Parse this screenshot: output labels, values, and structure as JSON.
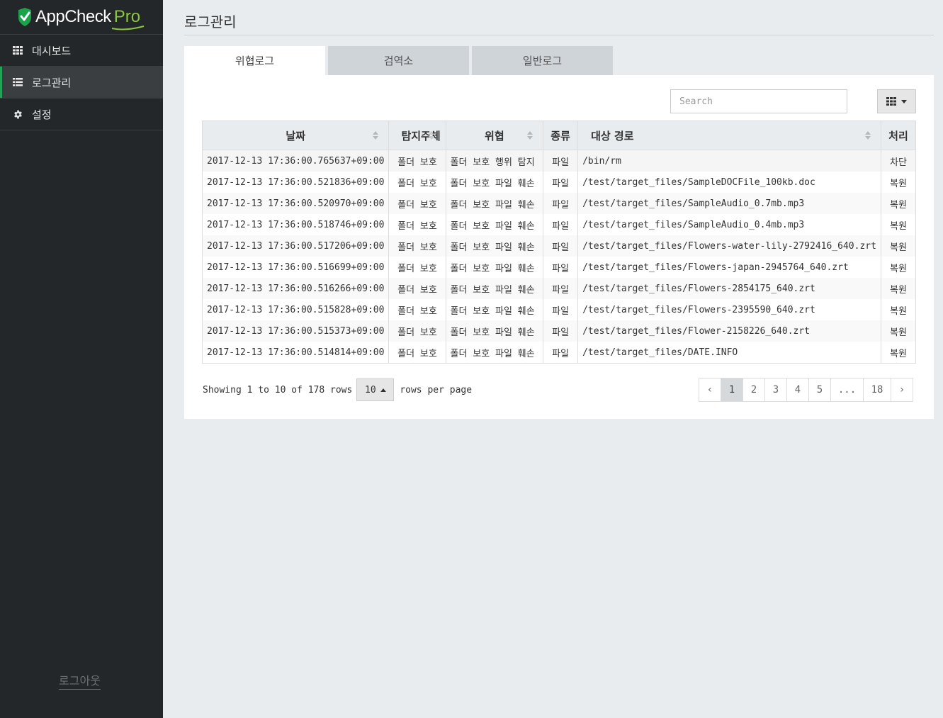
{
  "brand": {
    "name": "AppCheck",
    "suffix": "Pro"
  },
  "sidebar": {
    "items": [
      {
        "label": "대시보드",
        "icon": "grid-icon",
        "active": false
      },
      {
        "label": "로그관리",
        "icon": "list-icon",
        "active": true
      },
      {
        "label": "설정",
        "icon": "gear-icon",
        "active": false
      }
    ],
    "logout": "로그아웃"
  },
  "page": {
    "title": "로그관리"
  },
  "tabs": [
    {
      "label": "위협로그",
      "active": true
    },
    {
      "label": "검역소",
      "active": false
    },
    {
      "label": "일반로그",
      "active": false
    }
  ],
  "toolbar": {
    "search_placeholder": "Search"
  },
  "table": {
    "columns": [
      "날짜",
      "탐지주체",
      "위협",
      "종류",
      "대상 경로",
      "처리"
    ],
    "rows": [
      [
        "2017-12-13 17:36:00.765637+09:00",
        "폴더 보호",
        "폴더 보호 행위 탐지",
        "파일",
        "/bin/rm",
        "차단"
      ],
      [
        "2017-12-13 17:36:00.521836+09:00",
        "폴더 보호",
        "폴더 보호 파일 훼손",
        "파일",
        "/test/target_files/SampleDOCFile_100kb.doc",
        "복원"
      ],
      [
        "2017-12-13 17:36:00.520970+09:00",
        "폴더 보호",
        "폴더 보호 파일 훼손",
        "파일",
        "/test/target_files/SampleAudio_0.7mb.mp3",
        "복원"
      ],
      [
        "2017-12-13 17:36:00.518746+09:00",
        "폴더 보호",
        "폴더 보호 파일 훼손",
        "파일",
        "/test/target_files/SampleAudio_0.4mb.mp3",
        "복원"
      ],
      [
        "2017-12-13 17:36:00.517206+09:00",
        "폴더 보호",
        "폴더 보호 파일 훼손",
        "파일",
        "/test/target_files/Flowers-water-lily-2792416_640.zrt",
        "복원"
      ],
      [
        "2017-12-13 17:36:00.516699+09:00",
        "폴더 보호",
        "폴더 보호 파일 훼손",
        "파일",
        "/test/target_files/Flowers-japan-2945764_640.zrt",
        "복원"
      ],
      [
        "2017-12-13 17:36:00.516266+09:00",
        "폴더 보호",
        "폴더 보호 파일 훼손",
        "파일",
        "/test/target_files/Flowers-2854175_640.zrt",
        "복원"
      ],
      [
        "2017-12-13 17:36:00.515828+09:00",
        "폴더 보호",
        "폴더 보호 파일 훼손",
        "파일",
        "/test/target_files/Flowers-2395590_640.zrt",
        "복원"
      ],
      [
        "2017-12-13 17:36:00.515373+09:00",
        "폴더 보호",
        "폴더 보호 파일 훼손",
        "파일",
        "/test/target_files/Flower-2158226_640.zrt",
        "복원"
      ],
      [
        "2017-12-13 17:36:00.514814+09:00",
        "폴더 보호",
        "폴더 보호 파일 훼손",
        "파일",
        "/test/target_files/DATE.INFO",
        "복원"
      ]
    ]
  },
  "pager": {
    "showing": "Showing 1 to 10 of 178 rows",
    "page_size": "10",
    "rows_per_page": "rows per page",
    "prev": "‹",
    "pages": [
      "1",
      "2",
      "3",
      "4",
      "5",
      "...",
      "18"
    ],
    "current": "1",
    "next": "›"
  },
  "colors": {
    "accent": "#22a35a",
    "brand_green": "#8cc63f",
    "sidebar_bg": "#232729"
  }
}
